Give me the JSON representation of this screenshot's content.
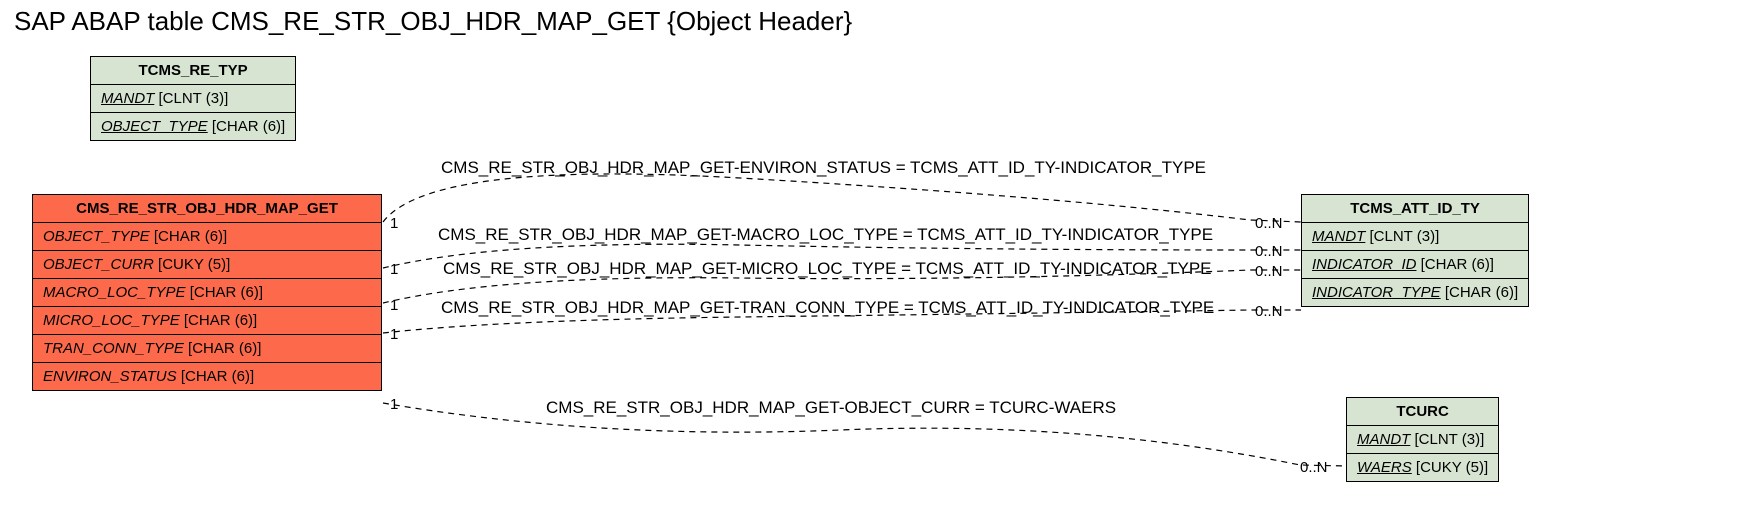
{
  "title": "SAP ABAP table CMS_RE_STR_OBJ_HDR_MAP_GET {Object Header}",
  "entities": {
    "tcms_re_typ": {
      "name": "TCMS_RE_TYP",
      "fields": [
        {
          "name": "MANDT",
          "type": "[CLNT (3)]",
          "key": true
        },
        {
          "name": "OBJECT_TYPE",
          "type": "[CHAR (6)]",
          "key": true
        }
      ]
    },
    "main": {
      "name": "CMS_RE_STR_OBJ_HDR_MAP_GET",
      "fields": [
        {
          "name": "OBJECT_TYPE",
          "type": "[CHAR (6)]",
          "key": false
        },
        {
          "name": "OBJECT_CURR",
          "type": "[CUKY (5)]",
          "key": false
        },
        {
          "name": "MACRO_LOC_TYPE",
          "type": "[CHAR (6)]",
          "key": false
        },
        {
          "name": "MICRO_LOC_TYPE",
          "type": "[CHAR (6)]",
          "key": false
        },
        {
          "name": "TRAN_CONN_TYPE",
          "type": "[CHAR (6)]",
          "key": false
        },
        {
          "name": "ENVIRON_STATUS",
          "type": "[CHAR (6)]",
          "key": false
        }
      ]
    },
    "tcms_att": {
      "name": "TCMS_ATT_ID_TY",
      "fields": [
        {
          "name": "MANDT",
          "type": "[CLNT (3)]",
          "key": true
        },
        {
          "name": "INDICATOR_ID",
          "type": "[CHAR (6)]",
          "key": true
        },
        {
          "name": "INDICATOR_TYPE",
          "type": "[CHAR (6)]",
          "key": true
        }
      ]
    },
    "tcurc": {
      "name": "TCURC",
      "fields": [
        {
          "name": "MANDT",
          "type": "[CLNT (3)]",
          "key": true
        },
        {
          "name": "WAERS",
          "type": "[CUKY (5)]",
          "key": true
        }
      ]
    }
  },
  "relations": [
    {
      "label": "CMS_RE_STR_OBJ_HDR_MAP_GET-ENVIRON_STATUS = TCMS_ATT_ID_TY-INDICATOR_TYPE",
      "card_left": "1",
      "card_right": "0..N"
    },
    {
      "label": "CMS_RE_STR_OBJ_HDR_MAP_GET-MACRO_LOC_TYPE = TCMS_ATT_ID_TY-INDICATOR_TYPE",
      "card_left": "1",
      "card_right": "0..N"
    },
    {
      "label": "CMS_RE_STR_OBJ_HDR_MAP_GET-MICRO_LOC_TYPE = TCMS_ATT_ID_TY-INDICATOR_TYPE",
      "card_left": "1",
      "card_right": "0..N"
    },
    {
      "label": "CMS_RE_STR_OBJ_HDR_MAP_GET-TRAN_CONN_TYPE = TCMS_ATT_ID_TY-INDICATOR_TYPE",
      "card_left": "1",
      "card_right": "0..N"
    },
    {
      "label": "CMS_RE_STR_OBJ_HDR_MAP_GET-OBJECT_CURR = TCURC-WAERS",
      "card_left": "1",
      "card_right": "0..N"
    }
  ]
}
